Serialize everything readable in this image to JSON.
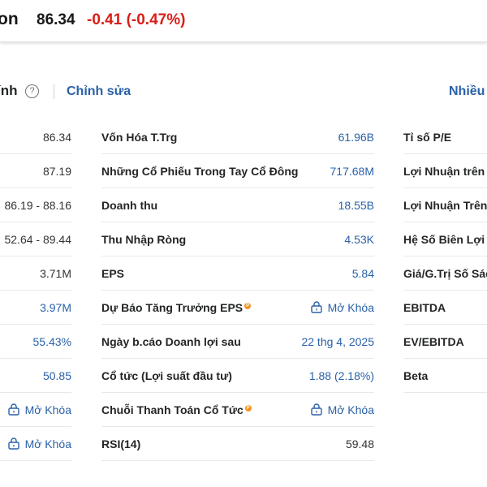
{
  "header": {
    "name": "on",
    "price": "86.34",
    "change": "-0.41 (-0.47%)"
  },
  "section": {
    "title_fragment": "ính",
    "help": "?",
    "edit": "Chỉnh sửa",
    "more": "Nhiều"
  },
  "left_values": [
    {
      "v": "86.34",
      "blue": false
    },
    {
      "v": "87.19",
      "blue": false
    },
    {
      "v": "86.19 - 88.16",
      "blue": false
    },
    {
      "v": "52.64 - 89.44",
      "blue": false
    },
    {
      "v": "3.71M",
      "blue": false
    },
    {
      "v": "3.97M",
      "blue": true
    },
    {
      "v": "55.43%",
      "blue": true
    },
    {
      "v": "50.85",
      "blue": true
    },
    {
      "v": "Mở Khóa",
      "blue": true,
      "lock": true
    },
    {
      "v": "Mở Khóa",
      "blue": true,
      "lock": true
    }
  ],
  "middle": [
    {
      "label": "Vốn Hóa T.Trg",
      "value": "61.96B"
    },
    {
      "label": "Những Cổ Phiếu Trong Tay Cổ Đông",
      "value": "717.68M"
    },
    {
      "label": "Doanh thu",
      "value": "18.55B"
    },
    {
      "label": "Thu Nhập Ròng",
      "value": "4.53K"
    },
    {
      "label": "EPS",
      "value": "5.84"
    },
    {
      "label": "Dự Báo Tăng Trưởng EPS",
      "value": "Mở Khóa",
      "pro": true,
      "lock": true
    },
    {
      "label": "Ngày b.cáo Doanh lợi sau",
      "value": "22 thg 4, 2025"
    },
    {
      "label": "Cổ tức (Lợi suất đầu tư)",
      "value": "1.88 (2.18%)"
    },
    {
      "label": "Chuỗi Thanh Toán Cổ Tức",
      "value": "Mở Khóa",
      "pro": true,
      "lock": true
    },
    {
      "label": "RSI(14)",
      "value": "59.48",
      "plain": true
    }
  ],
  "right": [
    "Tỉ số P/E",
    "Lợi Nhuận trên T",
    "Lợi Nhuận Trên",
    "Hệ Số Biên Lợi N",
    "Giá/G.Trị Số Sác",
    "EBITDA",
    "EV/EBITDA",
    "Beta"
  ],
  "colors": {
    "red": "#d91e18",
    "blue": "#2a61a8",
    "pro": "#f39321"
  }
}
